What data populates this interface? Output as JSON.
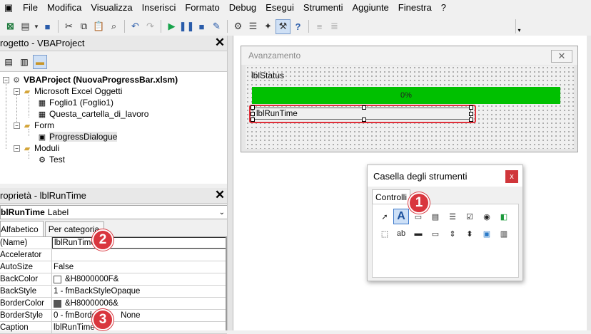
{
  "menu": {
    "app_icon": "vba-window-icon",
    "items": [
      "File",
      "Modifica",
      "Visualizza",
      "Inserisci",
      "Formato",
      "Debug",
      "Esegui",
      "Strumenti",
      "Aggiunte",
      "Finestra",
      "?"
    ]
  },
  "project_panel": {
    "title": "rogetto - VBAProject",
    "close": "✕",
    "tree": {
      "root": "VBAProject (NuovaProgressBar.xlsm)",
      "excel_objects_folder": "Microsoft Excel Oggetti",
      "sheet1": "Foglio1 (Foglio1)",
      "workbook": "Questa_cartella_di_lavoro",
      "forms_folder": "Form",
      "form1": "ProgressDialogue",
      "modules_folder": "Moduli",
      "module1": "Test"
    }
  },
  "properties_panel": {
    "title": "roprietà - lblRunTime",
    "close": "✕",
    "object_name": "blRunTime",
    "object_type": "Label",
    "tabs": [
      "Alfabetico",
      "Per categoria"
    ],
    "rows": [
      {
        "key": "(Name)",
        "value": "lblRunTime"
      },
      {
        "key": "Accelerator",
        "value": ""
      },
      {
        "key": "AutoSize",
        "value": "False"
      },
      {
        "key": "BackColor",
        "value": "&H8000000F&",
        "swatch": "#ffffff"
      },
      {
        "key": "BackStyle",
        "value": "1 - fmBackStyleOpaque"
      },
      {
        "key": "BorderColor",
        "value": "&H80000006&",
        "swatch": "#555555"
      },
      {
        "key": "BorderStyle",
        "value": "0 - fmBorde",
        "value_tail": "None"
      },
      {
        "key": "Caption",
        "value": "lblRunTime"
      }
    ]
  },
  "form_designer": {
    "title": "Avanzamento",
    "close": "✕",
    "label_status": "lblStatus",
    "progress_text": "0%",
    "progress_color": "#00c000",
    "runtime_label": "lblRunTime"
  },
  "toolbox": {
    "title": "Casella degli strumenti",
    "close": "x",
    "tab": "Controlli"
  },
  "badges": {
    "b1": "1",
    "b2": "2",
    "b3": "3"
  },
  "colors": {
    "highlight": "#e0303a",
    "badge": "#d9363e"
  }
}
